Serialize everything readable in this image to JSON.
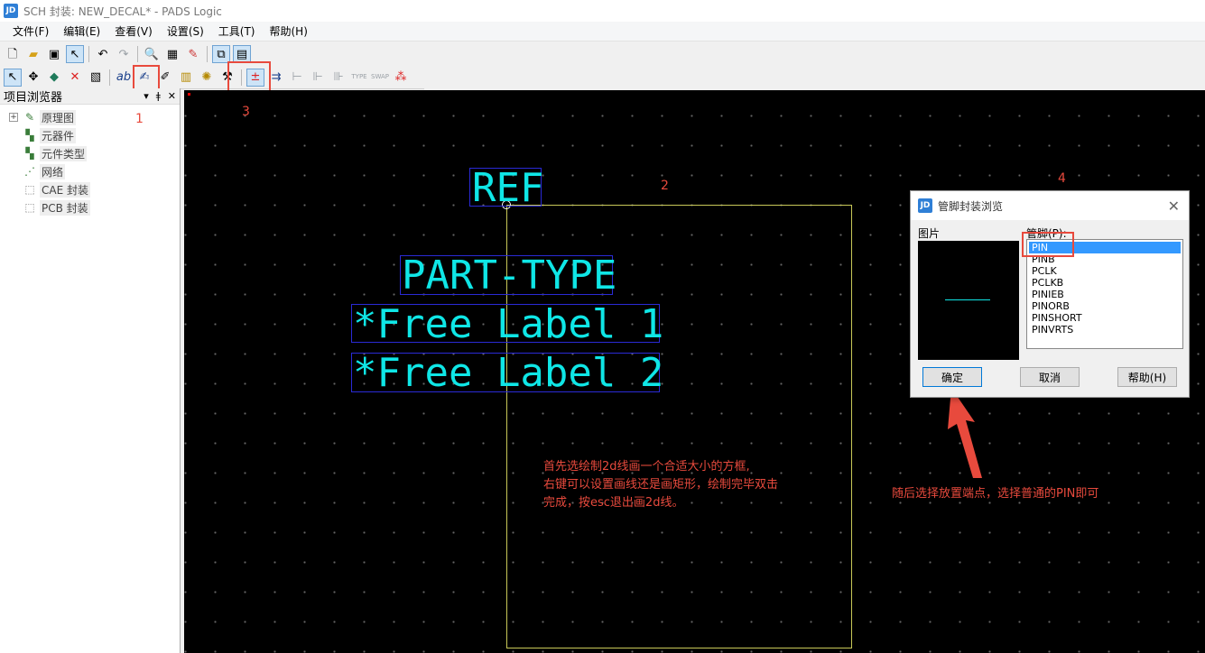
{
  "window": {
    "title": "SCH 封装: NEW_DECAL* - PADS Logic",
    "icon": "pads-app-icon"
  },
  "menu": [
    "文件(F)",
    "编辑(E)",
    "查看(V)",
    "设置(S)",
    "工具(T)",
    "帮助(H)"
  ],
  "sidebar": {
    "title": "项目浏览器",
    "items": [
      {
        "label": "原理图",
        "icon": "schematic-icon",
        "expandable": true
      },
      {
        "label": "元器件",
        "icon": "component-icon"
      },
      {
        "label": "元件类型",
        "icon": "part-type-icon"
      },
      {
        "label": "网络",
        "icon": "net-icon"
      },
      {
        "label": "CAE 封装",
        "icon": "cae-decal-icon"
      },
      {
        "label": "PCB 封装",
        "icon": "pcb-decal-icon"
      }
    ]
  },
  "canvas": {
    "ref_label": "REF",
    "part_type_label": "PART-TYPE",
    "free_label_1": "*Free Label 1",
    "free_label_2": "*Free Label 2",
    "label_color": "#0fe6e6",
    "outline_color": "#c8c858"
  },
  "annotations": {
    "step1": "1",
    "step2": "2",
    "step3": "3",
    "step4": "4",
    "note_left_line1": "首先选绘制2d线画一个合适大小的方框,",
    "note_left_line2": "右键可以设置画线还是画矩形，绘制完毕双击",
    "note_left_line3": "完成，按esc退出画2d线。",
    "note_right": "随后选择放置端点，选择普通的PIN即可",
    "color": "#e84a3d"
  },
  "dialog": {
    "title": "管脚封装浏览",
    "picture_label": "图片",
    "pins_label": "管脚(P):",
    "pins": [
      "PIN",
      "PINB",
      "PCLK",
      "PCLKB",
      "PINIEB",
      "PINORB",
      "PINSHORT",
      "PINVRTS"
    ],
    "selected_pin": "PIN",
    "ok": "确定",
    "cancel": "取消",
    "help": "帮助(H)"
  }
}
